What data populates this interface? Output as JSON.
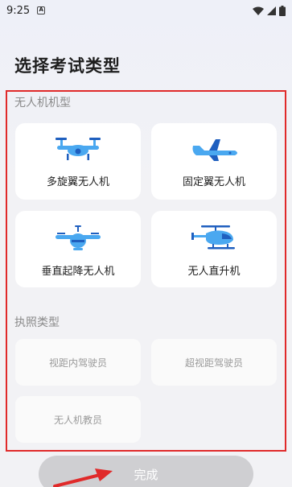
{
  "status_bar": {
    "time": "9:25",
    "notification_icon": "A"
  },
  "page": {
    "title": "选择考试类型"
  },
  "drone_section": {
    "label": "无人机机型",
    "items": [
      {
        "label": "多旋翼无人机",
        "icon": "multirotor-drone-icon"
      },
      {
        "label": "固定翼无人机",
        "icon": "fixed-wing-drone-icon"
      },
      {
        "label": "垂直起降无人机",
        "icon": "vtol-drone-icon"
      },
      {
        "label": "无人直升机",
        "icon": "helicopter-drone-icon"
      }
    ]
  },
  "license_section": {
    "label": "执照类型",
    "items": [
      {
        "label": "视距内驾驶员"
      },
      {
        "label": "超视距驾驶员"
      },
      {
        "label": "无人机教员"
      }
    ]
  },
  "footer": {
    "done_label": "完成"
  },
  "colors": {
    "accent_blue": "#4aa8f0",
    "highlight_red": "#e02a2a",
    "button_disabled": "#cfcfd2"
  }
}
